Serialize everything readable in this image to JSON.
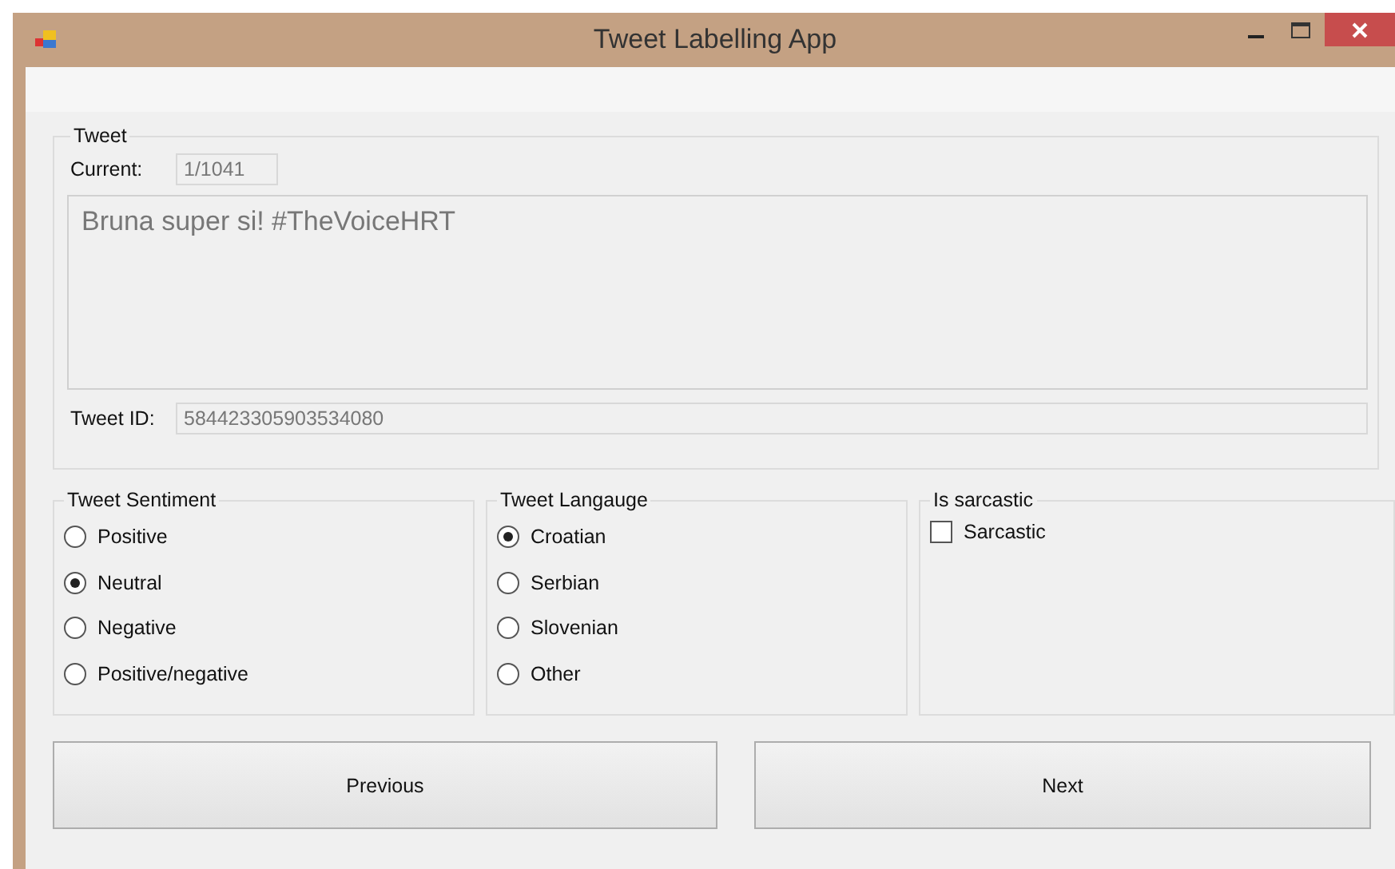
{
  "window": {
    "title": "Tweet Labelling App"
  },
  "tweet_group": {
    "title": "Tweet",
    "current_label": "Current:",
    "current_value": "1/1041",
    "text": "Bruna super si! #TheVoiceHRT",
    "id_label": "Tweet ID:",
    "id_value": "584423305903534080"
  },
  "sentiment": {
    "title": "Tweet Sentiment",
    "options": [
      {
        "label": "Positive",
        "selected": false
      },
      {
        "label": "Neutral",
        "selected": true
      },
      {
        "label": "Negative",
        "selected": false
      },
      {
        "label": "Positive/negative",
        "selected": false
      }
    ]
  },
  "language": {
    "title": "Tweet Langauge",
    "options": [
      {
        "label": "Croatian",
        "selected": true
      },
      {
        "label": "Serbian",
        "selected": false
      },
      {
        "label": "Slovenian",
        "selected": false
      },
      {
        "label": "Other",
        "selected": false
      }
    ]
  },
  "sarcasm": {
    "title": "Is sarcastic",
    "label": "Sarcastic",
    "checked": false
  },
  "buttons": [
    "Previous",
    "Next"
  ]
}
